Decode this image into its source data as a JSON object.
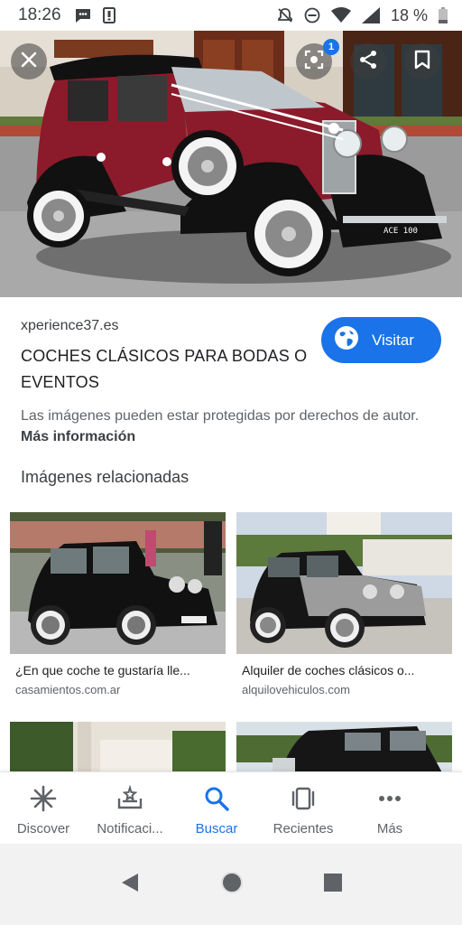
{
  "status_bar": {
    "time": "18:26",
    "battery": "18 %",
    "icons": [
      "chat-notification-icon",
      "sim-card-icon",
      "mute-icon",
      "do-not-disturb-icon",
      "wifi-icon",
      "signal-icon",
      "battery-icon"
    ]
  },
  "hero": {
    "lens_badge": "1",
    "plate": "ACE 100",
    "icons": [
      "close-icon",
      "lens-icon",
      "share-icon",
      "bookmark-icon"
    ]
  },
  "result": {
    "source": "xperience37.es",
    "title": "COCHES CLÁSICOS PARA BODAS O EVENTOS",
    "visit_label": "Visitar",
    "copyright_text": "Las imágenes pueden estar protegidas por derechos de autor. ",
    "more_info": "Más información"
  },
  "related": {
    "heading": "Imágenes relacionadas",
    "items": [
      {
        "caption": "¿En que coche te gustaría lle...",
        "domain": "casamientos.com.ar"
      },
      {
        "caption": "Alquiler de coches clásicos o...",
        "domain": "alquilovehiculos.com"
      },
      {
        "caption": "",
        "domain": ""
      },
      {
        "caption": "",
        "domain": ""
      }
    ]
  },
  "bottom_nav": {
    "items": [
      {
        "label": "Discover",
        "icon": "discover-icon"
      },
      {
        "label": "Notificaci...",
        "icon": "notifications-icon"
      },
      {
        "label": "Buscar",
        "icon": "search-icon"
      },
      {
        "label": "Recientes",
        "icon": "recents-icon"
      },
      {
        "label": "Más",
        "icon": "more-icon"
      }
    ],
    "active": "Buscar"
  },
  "colors": {
    "accent": "#1a73e8",
    "text_primary": "#202124",
    "text_secondary": "#5f6368"
  }
}
